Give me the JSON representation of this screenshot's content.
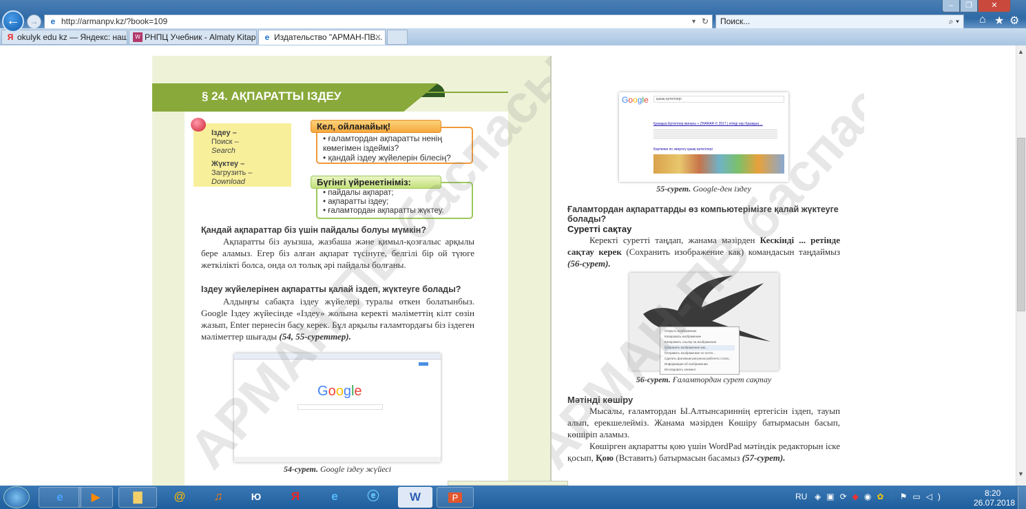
{
  "browser": {
    "address": "http://armanpv.kz/?book=109",
    "search_placeholder": "Поиск...",
    "tabs": [
      {
        "label": "okulyk edu kz — Яндекс: наш...",
        "icon": "yandex-icon"
      },
      {
        "label": "РНПЦ Учебник - Almaty Kitap...",
        "icon": "book-icon"
      },
      {
        "label": "Издательство \"АРМАН-ПВ...",
        "icon": "ie-icon",
        "active": true
      }
    ]
  },
  "left_page": {
    "chapter_title": "§ 24. АҚПАРАТТЫ ІЗДЕУ",
    "vocab": [
      {
        "term": "Іздеу –",
        "ru": "Поиск –",
        "en": "Search"
      },
      {
        "term": "Жүктеу –",
        "ru": "Загрузить –",
        "en": "Download"
      }
    ],
    "think_box": {
      "title": "Кел, ойланайық!",
      "items": [
        "ғаламтордан ақпаратты ненің көмегімен іздейміз?",
        "қандай іздеу жүйелерін білесің?"
      ]
    },
    "learn_box": {
      "title": "Бүгінгі үйренетініміз:",
      "items": [
        "пайдалы ақпарат;",
        "ақпаратты іздеу;",
        "ғаламтордан ақпаратты жүктеу."
      ]
    },
    "h1": "Қандай ақпараттар біз үшін пайдалы болуы мүмкін?",
    "p1": "Ақпаратты біз ауызша, жазбаша және қимыл-қозғалыс арқылы бере аламыз. Егер біз алған ақпарат түсінуге, белгілі бір ой түюге жеткілікті болса, онда ол толық әрі пайдалы болғаны.",
    "h2": "Іздеу жүйелерінен ақпаратты қалай іздеп, жүктеуге болады?",
    "p2": "Алдыңғы сабақта іздеу жүйелері туралы өткен болатынбыз. Google Іздеу жүйесінде «Іздеу» жолына керекті мәліметтің кілт сөзін жазып, Enter пернесін басу керек. Бұл арқылы ғаламтордағы біз іздеген мәліметтер шығады",
    "p2_ref": "(54, 55-суреттер).",
    "fig54_logo": "Google",
    "fig54_caption_num": "54-сурет.",
    "fig54_caption": "Google іздеу жүйесі",
    "watermark": "АРМАН-ПВ баспасы"
  },
  "right_page": {
    "fig55_logo": "Google",
    "fig55_query": "қазақ ертегілері",
    "fig55_result": "Қазақша Ертегілер жинағы » ZHARAR © 2017 | ertegi oqu Қазақша ...",
    "fig55_images_heading": "Картинки по запросу қазақ ертегілері",
    "fig55_caption_num": "55-сурет.",
    "fig55_caption": "Google-ден іздеу",
    "h1": "Ғаламтордан ақпараттарды өз компьютерімізге қалай жүктеуге болады?",
    "h2": "Суретті сақтау",
    "p1_a": "Керекті суретті таңдап, жанама мәзірден ",
    "p1_bold": "Кескінді ... ретінде сақтау керек",
    "p1_b": " (Сохранить изображение как) командасын таңдаймыз ",
    "p1_ref": "(56-сурет).",
    "context_menu": [
      "Открыть изображение",
      "Копировать изображение",
      "Копировать ссылку на изображение",
      "Сохранить изображение как...",
      "Отправить изображение по почте...",
      "Сделать фоновым рисунком рабочего стола...",
      "Информация об изображении",
      "Исследовать элемент"
    ],
    "fig56_caption_num": "56-сурет.",
    "fig56_caption": "Ғаламтордан сурет сақтау",
    "h3": "Мәтінді көшіру",
    "p2": "Мысалы, ғаламтордан Ы.Алтынсариннің ертегісін іздеп, тауып алып, ерекшелейміз. Жанама мәзірден Көшіру батырмасын басып, көшіріп аламыз.",
    "p3_a": "Көшірген ақпаратты қою үшін WordPad мәтіндік редакторын іске қосып, ",
    "p3_bold": "Қою",
    "p3_b": " (Вставить) батырмасын басамыз ",
    "p3_ref": "(57-сурет).",
    "watermark": "АРМАН-ПВ баспасы"
  },
  "taskbar": {
    "apps": [
      "ie-icon",
      "media-player-icon",
      "explorer-icon",
      "mail-icon",
      "music-icon",
      "yu-icon",
      "yandex-icon",
      "ie-icon",
      "edge-icon",
      "word-icon",
      "powerpoint-icon"
    ],
    "lang": "RU",
    "time": "8:20",
    "date": "26.07.2018"
  }
}
